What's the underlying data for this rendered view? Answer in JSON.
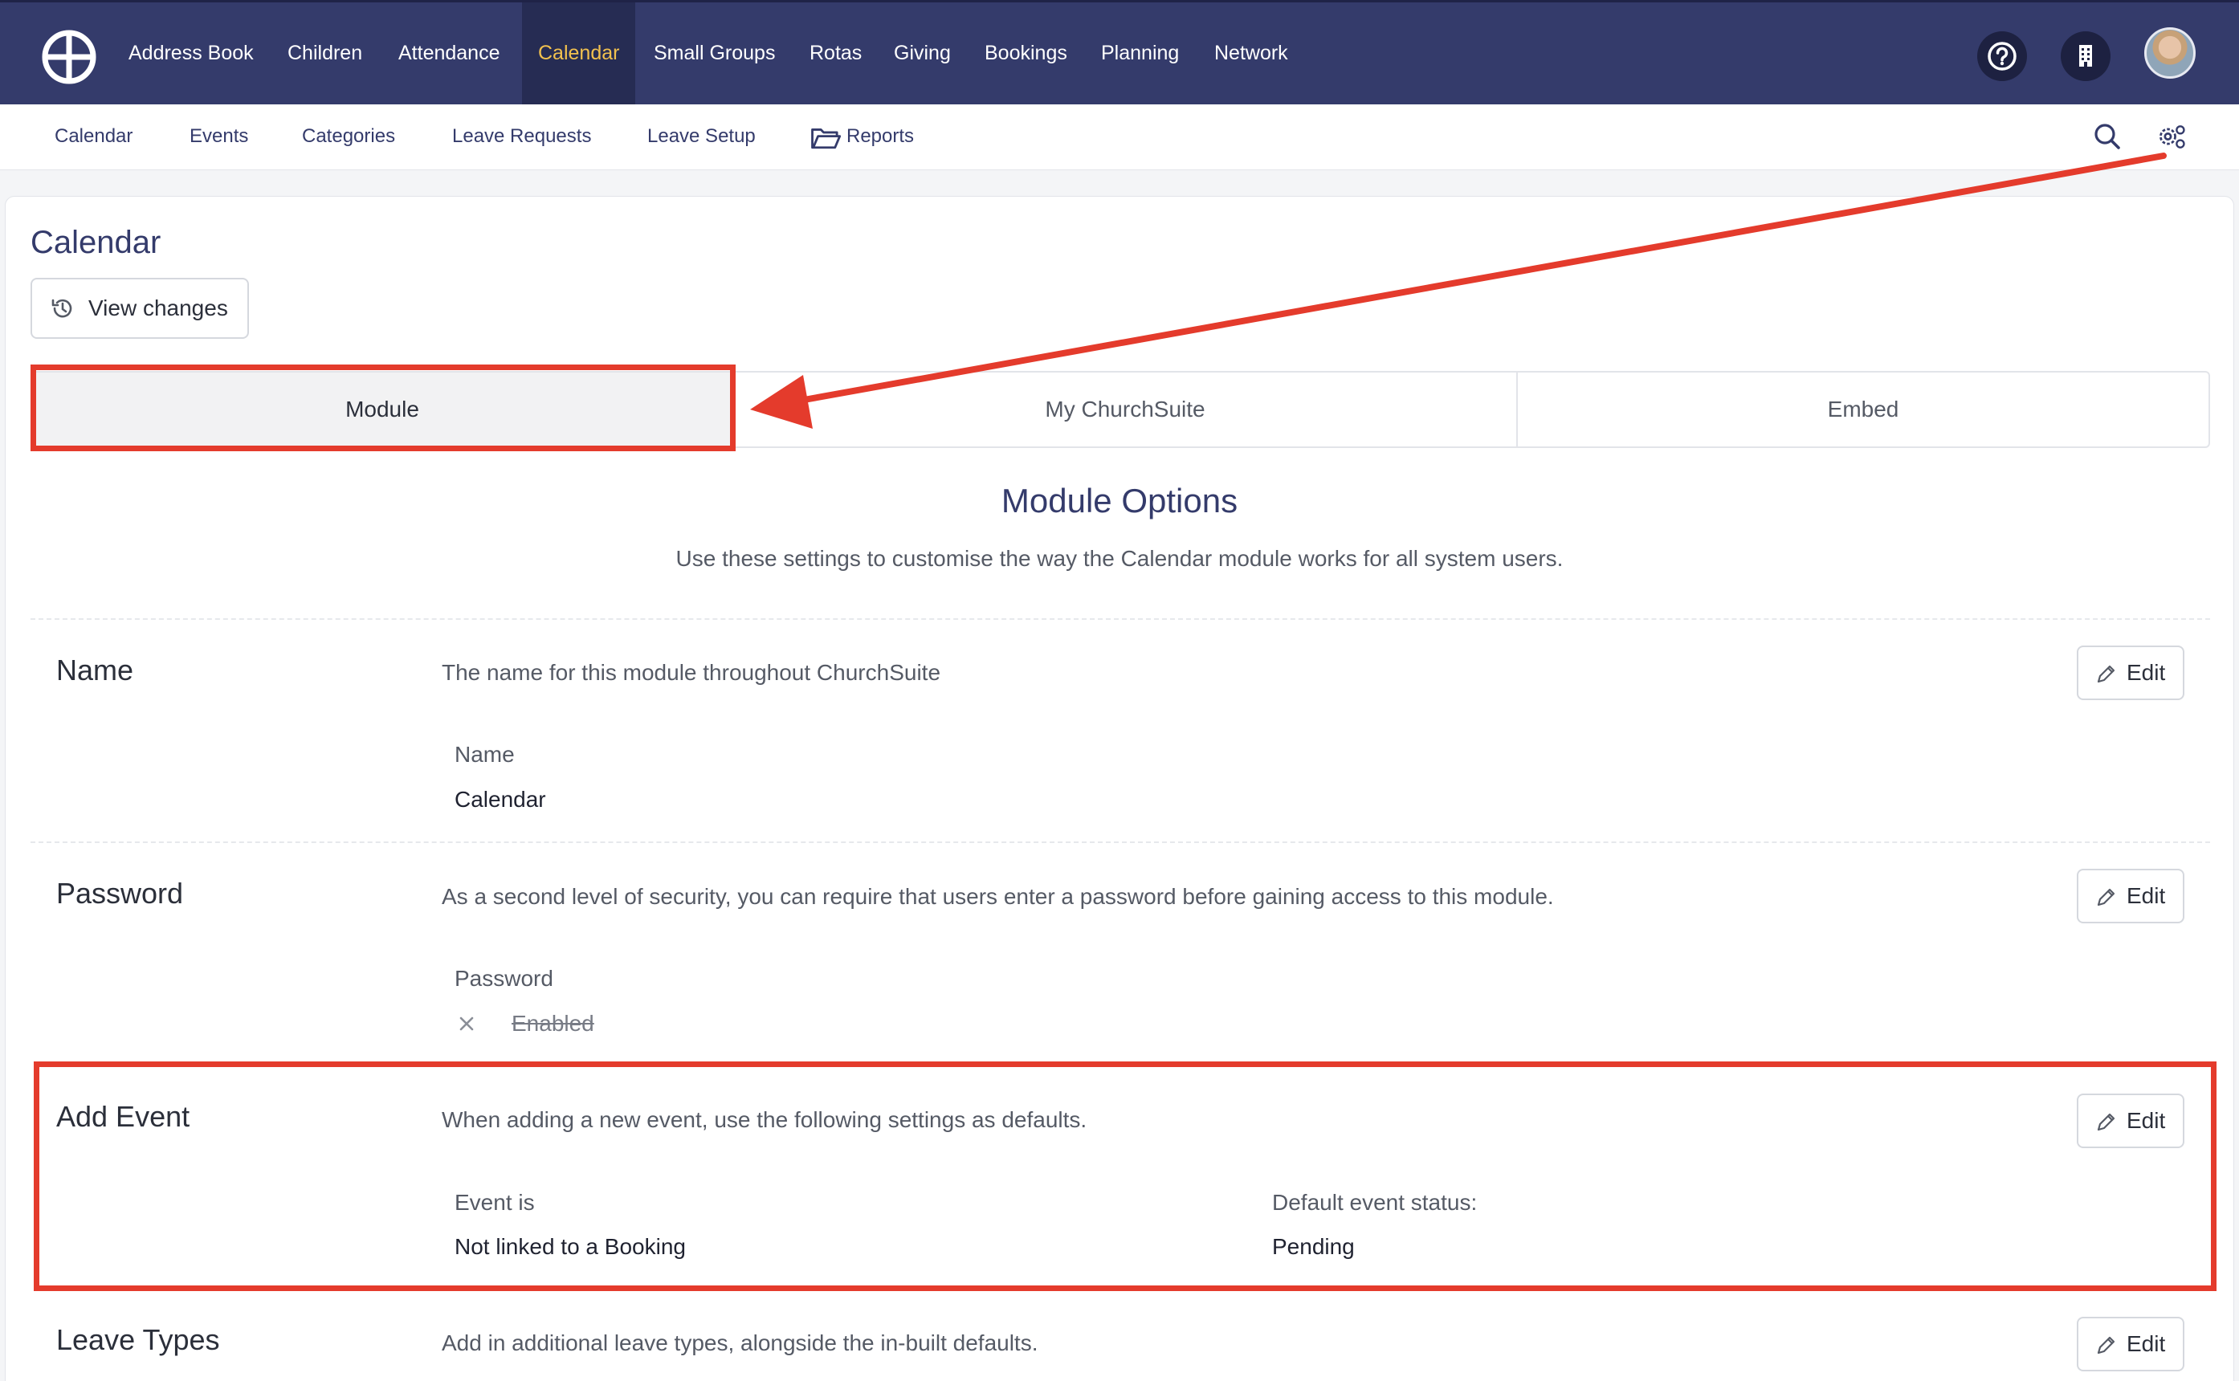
{
  "topnav": {
    "items": [
      "Address Book",
      "Children",
      "Attendance",
      "Calendar",
      "Small Groups",
      "Rotas",
      "Giving",
      "Bookings",
      "Planning",
      "Network"
    ],
    "active": "Calendar",
    "icons": [
      "churchsuite-logo-icon",
      "help-icon",
      "building-icon",
      "user-avatar"
    ]
  },
  "subnav": {
    "items": [
      "Calendar",
      "Events",
      "Categories",
      "Leave Requests",
      "Leave Setup",
      "Reports"
    ],
    "icons": [
      "folder-icon",
      "search-icon",
      "settings-gears-icon"
    ]
  },
  "page": {
    "title": "Calendar",
    "view_changes": "View changes"
  },
  "tabs": [
    "Module",
    "My ChurchSuite",
    "Embed"
  ],
  "module_options": {
    "title": "Module Options",
    "description": "Use these settings to customise the way the Calendar module works for all system users."
  },
  "edit_label": "Edit",
  "rows": [
    {
      "label": "Name",
      "description": "The name for this module throughout ChurchSuite",
      "fields": [
        {
          "label": "Name",
          "value": "Calendar"
        }
      ]
    },
    {
      "label": "Password",
      "description": "As a second level of security, you can require that users enter a password before gaining access to this module.",
      "fields": [
        {
          "label": "Password",
          "value": "Enabled",
          "state": "disabled"
        }
      ]
    },
    {
      "label": "Add Event",
      "description": "When adding a new event, use the following settings as defaults.",
      "fields": [
        {
          "label": "Event is",
          "value": "Not linked to a Booking"
        },
        {
          "label": "Default event status:",
          "value": "Pending"
        }
      ]
    },
    {
      "label": "Leave Types",
      "description": "Add in additional leave types, alongside the in-built defaults.",
      "fields": []
    }
  ],
  "colors": {
    "nav_bg": "#343b6b",
    "nav_active_text": "#f2c14e",
    "annotation": "#e43b2c"
  }
}
